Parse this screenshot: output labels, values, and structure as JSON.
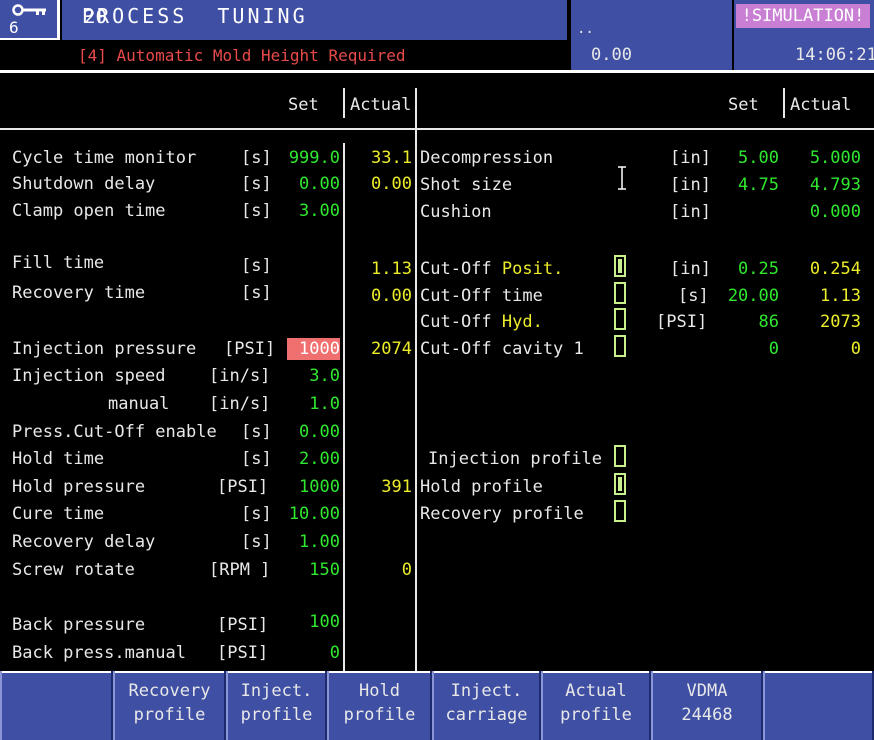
{
  "header": {
    "key_icon": "key-icon",
    "access_level": "6",
    "screen_number": "20",
    "screen_title": "PROCESS  TUNING",
    "alarm_text": "[4] Automatic Mold Height Required",
    "dots": "..",
    "value": "0.00",
    "mode_badge": "!SIMULATION!",
    "time": "14:06:21"
  },
  "left_panel": {
    "col_set": "Set",
    "col_actual": "Actual",
    "rows": [
      {
        "label": "Cycle time monitor",
        "unit": "[s]",
        "set": "999.0",
        "actual": "33.1"
      },
      {
        "label": "Shutdown delay",
        "unit": "[s]",
        "set": "0.00",
        "actual": "0.00"
      },
      {
        "label": "Clamp open time",
        "unit": "[s]",
        "set": "3.00",
        "actual": ""
      },
      {
        "label": "Fill time",
        "unit": "[s]",
        "set": "",
        "actual": "1.13"
      },
      {
        "label": "Recovery time",
        "unit": "[s]",
        "set": "",
        "actual": "0.00"
      },
      {
        "label": "Injection pressure",
        "unit": "[PSI]",
        "set": "1000",
        "actual": "2074"
      },
      {
        "label": "Injection speed",
        "unit": "[in/s]",
        "set": "3.0",
        "actual": ""
      },
      {
        "label": "manual",
        "unit": "[in/s]",
        "set": "1.0",
        "actual": ""
      },
      {
        "label": "Press.Cut-Off enable",
        "unit": "[s]",
        "set": "0.00",
        "actual": ""
      },
      {
        "label": "Hold time",
        "unit": "[s]",
        "set": "2.00",
        "actual": ""
      },
      {
        "label": "Hold pressure",
        "unit": "[PSI]",
        "set": "1000",
        "actual": "391"
      },
      {
        "label": "Cure time",
        "unit": "[s]",
        "set": "10.00",
        "actual": ""
      },
      {
        "label": "Recovery delay",
        "unit": "[s]",
        "set": "1.00",
        "actual": ""
      },
      {
        "label": "Screw rotate",
        "unit": "[RPM ]",
        "set": "150",
        "actual": "0"
      },
      {
        "label": "Back pressure",
        "unit": "[PSI]",
        "set": "100",
        "actual": ""
      },
      {
        "label": "Back press.manual",
        "unit": "[PSI]",
        "set": "0",
        "actual": ""
      }
    ]
  },
  "right_panel": {
    "col_set": "Set",
    "col_actual": "Actual",
    "rows": [
      {
        "label": "Decompression",
        "unit": "[in]",
        "set": "5.00",
        "actual": "5.000"
      },
      {
        "label": "Shot size",
        "unit": "[in]",
        "set": "4.75",
        "actual": "4.793"
      },
      {
        "label": "Cushion",
        "unit": "[in]",
        "set": "",
        "actual": "0.000"
      },
      {
        "label_a": "Cut-Off ",
        "label_b": "Posit.",
        "unit": "[in]",
        "set": "0.25",
        "actual": "0.254"
      },
      {
        "label_a": "Cut-Off time",
        "label_b": "",
        "unit": "[s]",
        "set": "20.00",
        "actual": "1.13"
      },
      {
        "label_a": "Cut-Off ",
        "label_b": "Hyd.",
        "unit": "[PSI]",
        "set": "86",
        "actual": "2073"
      },
      {
        "label_a": "Cut-Off cavity 1",
        "label_b": "",
        "unit": "",
        "set": "0",
        "actual": "0"
      }
    ],
    "profiles": [
      {
        "label": "Injection profile"
      },
      {
        "label": "Hold profile"
      },
      {
        "label": "Recovery profile"
      }
    ]
  },
  "buttons": [
    {
      "line1": "Recovery",
      "line2": "profile"
    },
    {
      "line1": "Inject.",
      "line2": "profile"
    },
    {
      "line1": "Hold",
      "line2": "profile"
    },
    {
      "line1": "Inject.",
      "line2": "carriage"
    },
    {
      "line1": "Actual",
      "line2": "profile"
    },
    {
      "line1": "VDMA",
      "line2": "24468"
    }
  ]
}
